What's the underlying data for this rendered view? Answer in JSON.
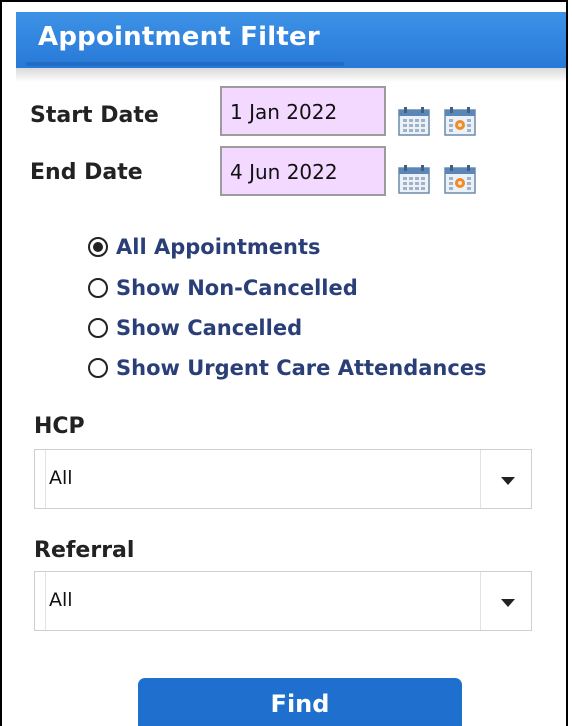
{
  "header": {
    "title": "Appointment Filter"
  },
  "start_date": {
    "label": "Start Date",
    "value": "1 Jan 2022"
  },
  "end_date": {
    "label": "End Date",
    "value": "4 Jun 2022"
  },
  "appointment_options": [
    {
      "label": "All Appointments",
      "checked": true
    },
    {
      "label": "Show Non-Cancelled",
      "checked": false
    },
    {
      "label": "Show Cancelled",
      "checked": false
    },
    {
      "label": "Show Urgent Care Attendances",
      "checked": false
    }
  ],
  "hcp": {
    "label": "HCP",
    "value": "All"
  },
  "referral": {
    "label": "Referral",
    "value": "All"
  },
  "find_button": {
    "label": "Find"
  },
  "colors": {
    "header_blue": "#2b7ddb",
    "date_field_bg": "#f3d9ff",
    "radio_label": "#2a3f78",
    "button_blue": "#1f6fcf"
  },
  "icons": [
    "calendar-icon",
    "calendar-today-icon",
    "chevron-down-icon"
  ]
}
